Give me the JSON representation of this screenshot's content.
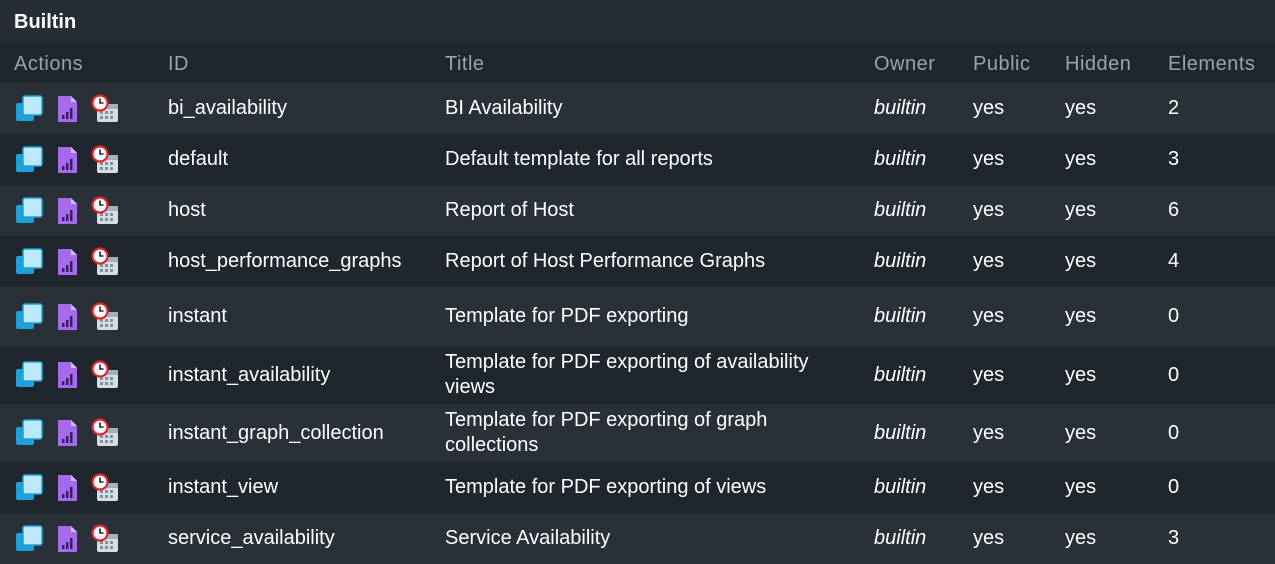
{
  "section": {
    "title": "Builtin"
  },
  "columns": {
    "actions": "Actions",
    "id": "ID",
    "title": "Title",
    "owner": "Owner",
    "public": "Public",
    "hidden": "Hidden",
    "elements": "Elements"
  },
  "icons": {
    "clone": "clone-icon",
    "report": "report-icon",
    "schedule": "schedule-icon"
  },
  "colors": {
    "clone": "#1ea1d8",
    "clone_light": "#bde9fa",
    "report": "#a56bea",
    "schedule_ring": "#e0242f"
  },
  "rows": [
    {
      "id": "bi_availability",
      "title": "BI Availability",
      "owner": "builtin",
      "public": "yes",
      "hidden": "yes",
      "elements": "2"
    },
    {
      "id": "default",
      "title": "Default template for all reports",
      "owner": "builtin",
      "public": "yes",
      "hidden": "yes",
      "elements": "3"
    },
    {
      "id": "host",
      "title": "Report of Host",
      "owner": "builtin",
      "public": "yes",
      "hidden": "yes",
      "elements": "6"
    },
    {
      "id": "host_performance_graphs",
      "title": "Report of Host Performance Graphs",
      "owner": "builtin",
      "public": "yes",
      "hidden": "yes",
      "elements": "4"
    },
    {
      "id": "instant",
      "title": "Template for PDF exporting",
      "owner": "builtin",
      "public": "yes",
      "hidden": "yes",
      "elements": "0"
    },
    {
      "id": "instant_availability",
      "title": "Template for PDF exporting of availability views",
      "owner": "builtin",
      "public": "yes",
      "hidden": "yes",
      "elements": "0"
    },
    {
      "id": "instant_graph_collection",
      "title": "Template for PDF exporting of graph collections",
      "owner": "builtin",
      "public": "yes",
      "hidden": "yes",
      "elements": "0"
    },
    {
      "id": "instant_view",
      "title": "Template for PDF exporting of views",
      "owner": "builtin",
      "public": "yes",
      "hidden": "yes",
      "elements": "0"
    },
    {
      "id": "service_availability",
      "title": "Service Availability",
      "owner": "builtin",
      "public": "yes",
      "hidden": "yes",
      "elements": "3"
    }
  ]
}
